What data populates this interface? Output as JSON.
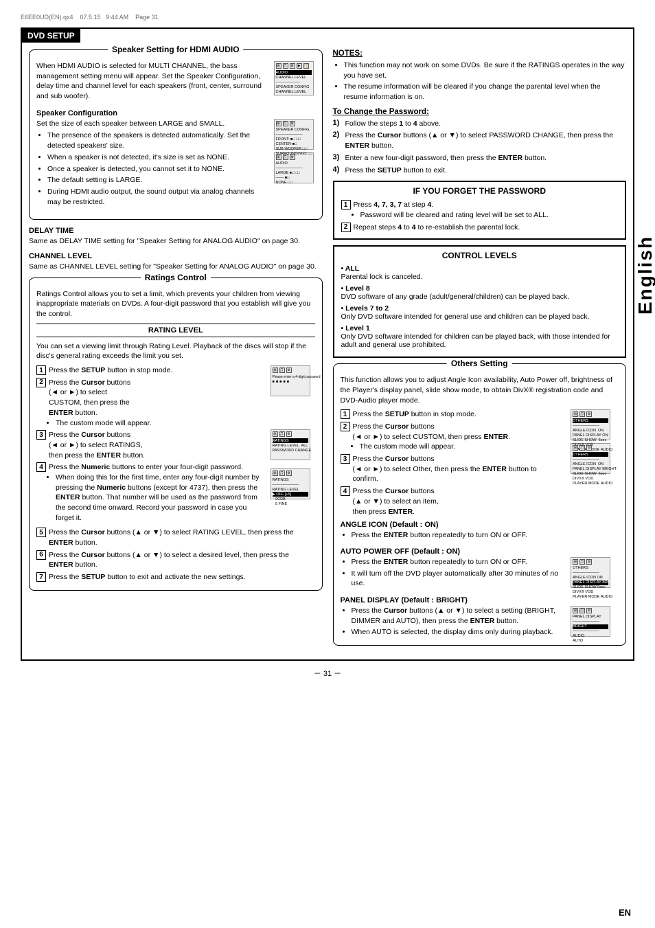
{
  "meta": {
    "file": "E6EE0UD(EN).qx4",
    "date": "07.5.15",
    "time": "9:44 AM",
    "page": "Page 31"
  },
  "page_title": "DVD SETUP",
  "left_column": {
    "speaker_section": {
      "title": "Speaker Setting for HDMI AUDIO",
      "intro": "When HDMI AUDIO is selected for MULTI CHANNEL, the bass management setting menu will appear. Set the Speaker Configuration, delay time and channel level for each speakers (front, center, surround and sub woofer).",
      "sub_sections": [
        {
          "heading": "Speaker Configuration",
          "text": "Set the size of each speaker between LARGE and SMALL.",
          "bullets": [
            "The presence of the speakers is detected automatically. Set the detected speakers' size.",
            "When a speaker is not detected, it's size is set as NONE.",
            "Once a speaker is detected, you cannot set it to NONE.",
            "The default setting is LARGE.",
            "During HDMI audio output, the sound output via analog channels may be restricted."
          ]
        }
      ]
    },
    "delay_time": {
      "heading": "DELAY TIME",
      "text": "Same as DELAY TIME setting for \"Speaker Setting for ANALOG AUDIO\" on page 30."
    },
    "channel_level": {
      "heading": "CHANNEL LEVEL",
      "text": "Same as CHANNEL LEVEL setting for \"Speaker Setting for ANALOG AUDIO\" on page 30."
    },
    "ratings_control": {
      "title": "Ratings Control",
      "intro": "Ratings Control allows you to set a limit, which prevents your children from viewing inappropriate materials on DVDs. A four-digit password that you establish will give you the control.",
      "rating_level_heading": "RATING LEVEL",
      "rating_level_text": "You can set a viewing limit through Rating Level. Playback of the discs will stop if the disc's general rating exceeds the limit you set.",
      "steps": [
        {
          "num": "1",
          "text": "Press the",
          "bold": "SETUP",
          "text2": "button in stop mode."
        },
        {
          "num": "2",
          "bold": "Cursor",
          "text": "Press the",
          "text2": "buttons",
          "details": "(◄ or ►) to select CUSTOM, then press the ENTER button.",
          "sub_bullets": [
            "The custom mode will appear."
          ]
        },
        {
          "num": "3",
          "text": "Press the",
          "bold": "Cursor",
          "text2": "buttons (◄ or ►) to select RATINGS, then press the ENTER button."
        },
        {
          "num": "4",
          "text": "Press the",
          "bold": "Numeric",
          "text2": "buttons to enter your four-digit password.",
          "sub_bullets": [
            "When doing this for the first time, enter any four-digit number by pressing the Numeric buttons (except for 4737), then press the ENTER button. That number will be used as the password from the second time onward. Record your password in case you forget it."
          ]
        },
        {
          "num": "5",
          "text": "Press the Cursor buttons (▲ or ▼) to select RATING LEVEL, then press the ENTER button."
        },
        {
          "num": "6",
          "text": "Press the Cursor buttons (▲ or ▼) to select a desired level, then press the ENTER button."
        },
        {
          "num": "7",
          "text": "Press the SETUP button to exit and activate the new settings."
        }
      ]
    }
  },
  "right_column": {
    "notes": {
      "title": "NOTES:",
      "bullets": [
        "This function may not work on some DVDs. Be sure if the RATINGS operates in the way you have set.",
        "The resume information will be cleared if you change the parental level when the resume information is on."
      ]
    },
    "change_password": {
      "title": "To Change the Password:",
      "steps": [
        "Follow the steps 1 to 4 above.",
        "Press the Cursor buttons (▲ or ▼) to select PASSWORD CHANGE, then press the ENTER button.",
        "Enter a new four-digit password, then press the ENTER button.",
        "Press the SETUP button to exit."
      ]
    },
    "forget_password": {
      "title": "IF YOU FORGET THE PASSWORD",
      "steps": [
        {
          "num": "1",
          "text": "Press 4, 7, 3, 7 at step 4.",
          "sub_bullets": [
            "Password will be cleared and rating level will be set to ALL."
          ]
        },
        {
          "num": "2",
          "text": "Repeat steps 4 to 4 to re-establish the parental lock."
        }
      ]
    },
    "control_levels": {
      "title": "CONTROL LEVELS",
      "items": [
        {
          "heading": "ALL",
          "text": "Parental lock is canceled."
        },
        {
          "heading": "Level 8",
          "text": "DVD software of any grade (adult/general/children) can be played back."
        },
        {
          "heading": "Levels 7 to 2",
          "text": "Only DVD software intended for general use and children can be played back."
        },
        {
          "heading": "Level 1",
          "text": "Only DVD software intended for children can be played back, with those intended for adult and general use prohibited."
        }
      ]
    },
    "others_setting": {
      "title": "Others Setting",
      "intro": "This function allows you to adjust Angle Icon availability, Auto Power off, brightness of the Player's display panel, slide show mode, to obtain DivX® registration code and DVD-Audio player mode.",
      "steps": [
        {
          "num": "1",
          "text": "Press the SETUP button in stop mode."
        },
        {
          "num": "2",
          "text": "Press the Cursor buttons (◄ or ►) to select CUSTOM, then press ENTER.",
          "sub_bullets": [
            "The custom mode will appear."
          ]
        },
        {
          "num": "3",
          "text": "Press the Cursor buttons (◄ or ►) to select Other, then press the ENTER button to confirm."
        },
        {
          "num": "4",
          "text": "Press the Cursor buttons (▲ or ▼) to select an item, then press ENTER."
        }
      ],
      "angle_icon": {
        "heading": "ANGLE ICON (Default : ON)",
        "text": "Press the ENTER button repeatedly to turn ON or OFF."
      },
      "auto_power": {
        "heading": "AUTO POWER OFF (Default : ON)",
        "bullets": [
          "Press the ENTER button repeatedly to turn ON or OFF.",
          "It will turn off the DVD player automatically after 30 minutes of no use."
        ]
      },
      "panel_display": {
        "heading": "PANEL DISPLAY (Default : BRIGHT)",
        "bullets": [
          "Press the Cursor buttons (▲ or ▼) to select a setting (BRIGHT, DIMMER and AUTO), then press the ENTER button.",
          "When AUTO is selected, the display dims only during playback."
        ]
      }
    }
  },
  "sidebar_label": "English",
  "page_number": "－ 31 －",
  "en_label": "EN"
}
